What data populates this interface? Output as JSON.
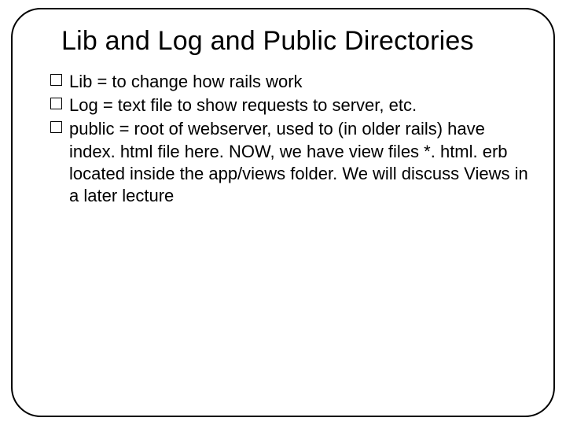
{
  "title": "Lib and Log and Public Directories",
  "bullets": [
    "Lib = to change how rails work",
    "Log = text file to show requests to server, etc.",
    "public = root of webserver, used to (in older rails) have index. html file here.  NOW, we have view files *. html. erb located inside the app/views folder.  We will discuss Views in a later lecture"
  ]
}
